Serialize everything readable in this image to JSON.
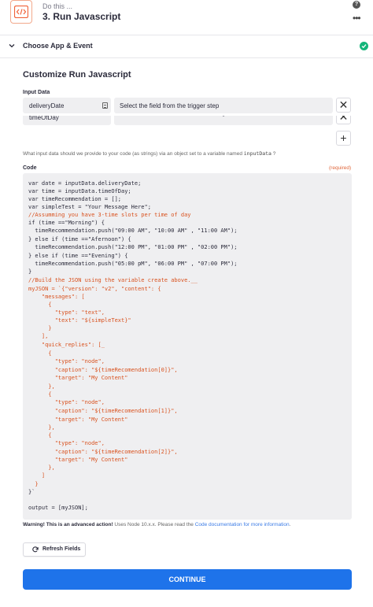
{
  "header": {
    "step_hint": "Do this ...",
    "step_title": "3. Run Javascript",
    "help_glyph": "?",
    "more_glyph": "•••"
  },
  "section": {
    "label": "Choose App & Event"
  },
  "panel": {
    "title": "Customize Run Javascript"
  },
  "input_data": {
    "label": "Input Data",
    "rows": [
      {
        "key": "deliveryDate",
        "value": "Select the field from the trigger step"
      },
      {
        "key": "timeOfDay",
        "value": "\" "
      }
    ],
    "helper_prefix": "What input data should we provide to your code (as strings) via an object set to a variable named",
    "helper_code": "inputData",
    "helper_suffix": "?"
  },
  "code": {
    "label": "Code",
    "required": "(required)",
    "lines": [
      "var date = inputData.deliveryDate;",
      "var time = inputData.timeOfDay;",
      "var timeRecommendation = [];",
      "var simpleTest = \"Your Message Here\";",
      "//Assumming you have 3-time slots per time of day",
      "if (time ==\"Morning\") {",
      "  timeRecommendation.push(\"09:00 AM\", \"10:00 AM\" , \"11:00 AM\");",
      "} else if (time ==\"Afernoon\") {",
      "  timeRecommendation.push(\"12:00 PM\", \"01:00 PM\" , \"02:00 PM\");",
      "} else if (time ==\"Evening\") {",
      "  timeRecommendation.push(\"05:00 pM\", \"06:00 PM\" , \"07:00 PM\");",
      "}",
      "//Build the JSON using the variable create above.__",
      "myJSON = `{\"version\": \"v2\", \"content\": {",
      "    \"messages\": [",
      "      {",
      "        \"type\": \"text\",",
      "        \"text\": \"${simpleText}\"",
      "      }",
      "    ],",
      "    \"quick_replies\": [_",
      "      {",
      "        \"type\": \"node\",",
      "        \"caption\": \"${timeRecomendation[0]}\",",
      "        \"target\": \"My Content\"",
      "      },",
      "      {",
      "        \"type\": \"node\",",
      "        \"caption\": \"${timeRecomendation[1]}\",",
      "        \"target\": \"My Content\"",
      "      },",
      "      {",
      "        \"type\": \"node\",",
      "        \"caption\": \"${timeRecomendation[2]}\",",
      "        \"target\": \"My Content\"",
      "      },",
      "    ]",
      "  }",
      "}`",
      "",
      "output = [myJSON];"
    ]
  },
  "warning": {
    "strong": "Warning! This is an advanced action!",
    "text": " Uses Node 10.x.x. Please read the ",
    "link": "Code documentation for more information",
    "end": "."
  },
  "buttons": {
    "refresh": "Refresh Fields",
    "continue": "CONTINUE",
    "remove_glyph": "✕",
    "add_glyph": "+"
  },
  "colors": {
    "accent": "#1e73ea",
    "success": "#13b57a",
    "string": "#d9521f",
    "required": "#e0663a"
  }
}
